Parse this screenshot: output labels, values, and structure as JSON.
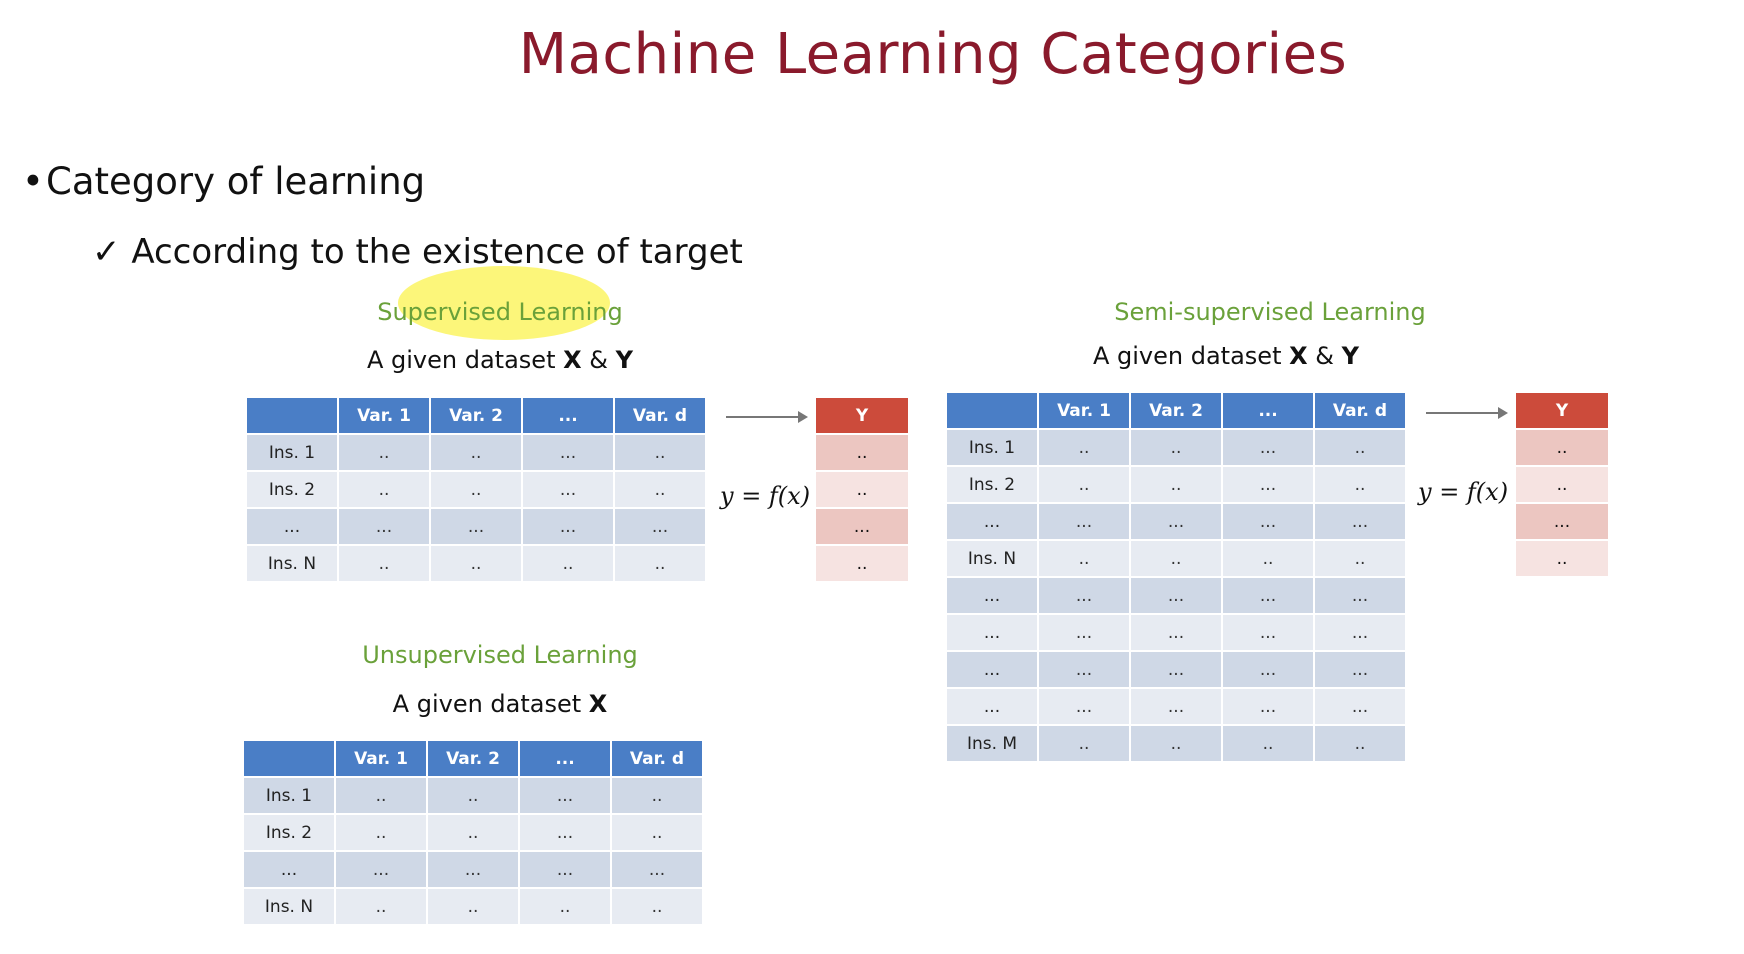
{
  "title": "Machine Learning Categories",
  "bullet": "Category of learning",
  "sub_bullet_mark": "✓",
  "sub_bullet": "According to the existence of target",
  "supervised": {
    "title": "Supervised Learning",
    "caption_prefix": "A given dataset ",
    "caption_x": "X",
    "caption_amp": " & ",
    "caption_y": "Y",
    "formula": "y = f(x)",
    "headers": [
      "",
      "Var. 1",
      "Var. 2",
      "...",
      "Var. d"
    ],
    "rows": [
      [
        "Ins. 1",
        "..",
        "..",
        "...",
        ".."
      ],
      [
        "Ins. 2",
        "..",
        "..",
        "...",
        ".."
      ],
      [
        "...",
        "...",
        "...",
        "...",
        "..."
      ],
      [
        "Ins. N",
        "..",
        "..",
        "..",
        ".."
      ]
    ],
    "y_header": "Y",
    "y_values": [
      "..",
      "..",
      "...",
      ".."
    ]
  },
  "unsupervised": {
    "title": "Unsupervised Learning",
    "caption_prefix": "A given dataset ",
    "caption_x": "X",
    "headers": [
      "",
      "Var. 1",
      "Var. 2",
      "...",
      "Var. d"
    ],
    "rows": [
      [
        "Ins. 1",
        "..",
        "..",
        "...",
        ".."
      ],
      [
        "Ins. 2",
        "..",
        "..",
        "...",
        ".."
      ],
      [
        "...",
        "...",
        "...",
        "...",
        "..."
      ],
      [
        "Ins. N",
        "..",
        "..",
        "..",
        ".."
      ]
    ]
  },
  "semi": {
    "title": "Semi-supervised Learning",
    "caption_prefix": "A given dataset ",
    "caption_x": "X",
    "caption_amp": " & ",
    "caption_y": "Y",
    "formula": "y = f(x)",
    "headers": [
      "",
      "Var. 1",
      "Var. 2",
      "...",
      "Var. d"
    ],
    "rows": [
      [
        "Ins. 1",
        "..",
        "..",
        "...",
        ".."
      ],
      [
        "Ins. 2",
        "..",
        "..",
        "...",
        ".."
      ],
      [
        "...",
        "...",
        "...",
        "...",
        "..."
      ],
      [
        "Ins. N",
        "..",
        "..",
        "..",
        ".."
      ],
      [
        "...",
        "...",
        "...",
        "...",
        "..."
      ],
      [
        "...",
        "...",
        "...",
        "...",
        "..."
      ],
      [
        "...",
        "...",
        "...",
        "...",
        "..."
      ],
      [
        "...",
        "...",
        "...",
        "...",
        "..."
      ],
      [
        "Ins. M",
        "..",
        "..",
        "..",
        ".."
      ]
    ],
    "y_header": "Y",
    "y_values": [
      "..",
      "..",
      "...",
      ".."
    ]
  },
  "colors": {
    "title": "#8a1a2c",
    "section_title": "#6aa13a",
    "table_header": "#4a7ec6",
    "y_header": "#cc4b3b",
    "highlight": "#f7ee2a"
  }
}
